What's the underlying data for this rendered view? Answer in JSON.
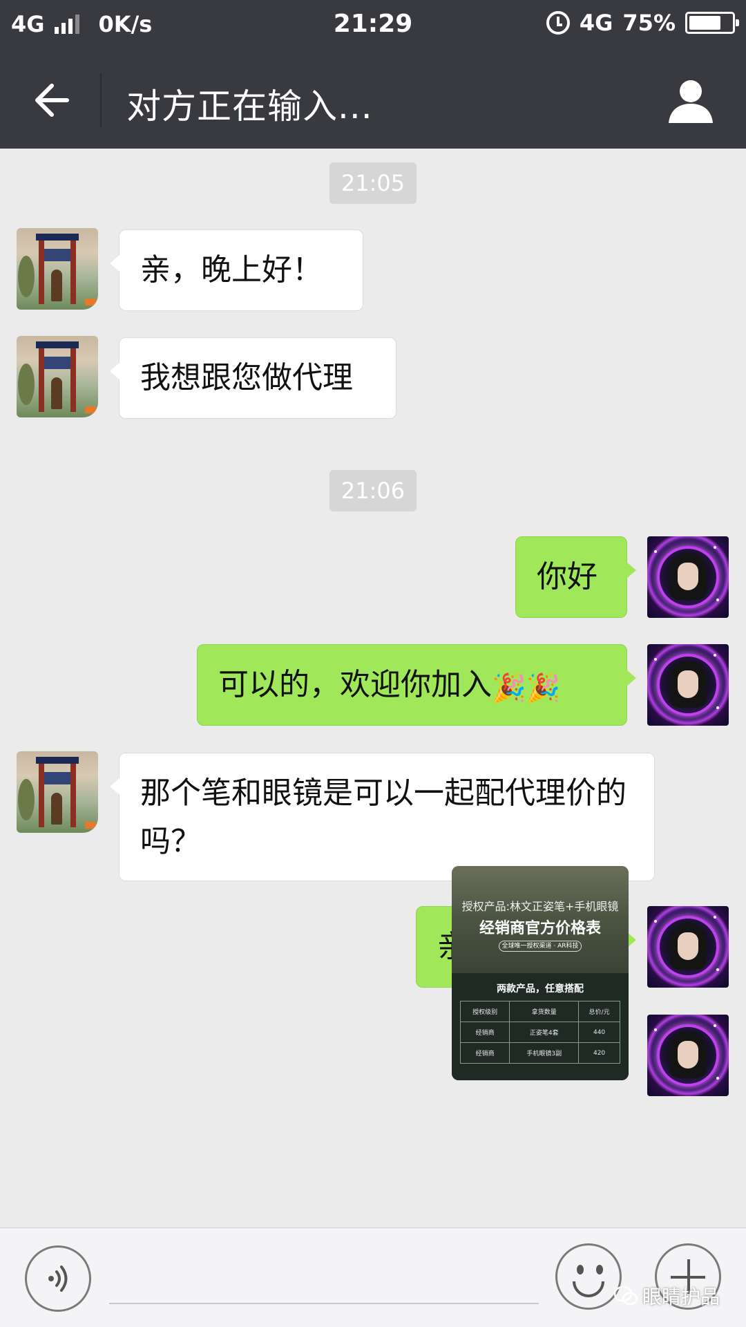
{
  "status_bar": {
    "network": "4G",
    "speed": "0K/s",
    "time": "21:29",
    "network_right": "4G",
    "battery": "75%",
    "battery_fraction": 0.75
  },
  "header": {
    "title": "对方正在输入...",
    "back_icon": "arrow-left-icon",
    "profile_icon": "person-icon"
  },
  "messages": {
    "ts1": "21:05",
    "m1": "亲，晚上好！",
    "m2": "我想跟您做代理",
    "ts2": "21:06",
    "m3": "你好",
    "m4": "可以的，欢迎你加入",
    "m4_emoji": "🎉🎉",
    "m5": "那个笔和眼镜是可以一起配代理价的吗？",
    "m6": "亲，可以的"
  },
  "image_message": {
    "line1": "授权产品:林文正姿笔+手机眼镜",
    "line2": "经销商官方价格表",
    "line3": "全球唯一授权渠道 · AR科技",
    "line4": "两款产品，任意搭配",
    "table": [
      [
        "授权级别",
        "拿货数量",
        "总价/元"
      ],
      [
        "经销商",
        "正姿笔4套",
        "440"
      ],
      [
        "经销商",
        "手机眼镜3副",
        "420"
      ]
    ]
  },
  "input_bar": {
    "voice_icon": "voice-icon",
    "emoji_icon": "emoji-icon",
    "plus_icon": "plus-icon",
    "placeholder": ""
  },
  "watermark": "眼睛护品",
  "colors": {
    "header_bg": "#393a3f",
    "chat_bg": "#ebebeb",
    "sent_bubble": "#a0e75a",
    "received_bubble": "#ffffff"
  }
}
